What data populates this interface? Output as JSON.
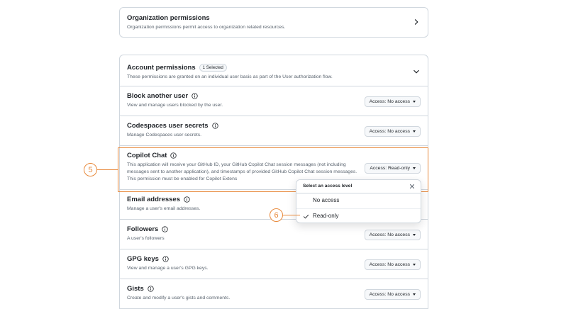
{
  "org": {
    "title": "Organization permissions",
    "description": "Organization permissions permit access to organization related resources."
  },
  "account": {
    "title": "Account permissions",
    "badge": "1 Selected",
    "description": "These permissions are granted on an individual user basis as part of the User authorization flow.",
    "rows": [
      {
        "title": "Block another user",
        "description": "View and manage users blocked by the user.",
        "access": "Access: No access"
      },
      {
        "title": "Codespaces user secrets",
        "description": "Manage Codespaces user secrets.",
        "access": "Access: No access"
      },
      {
        "title": "Copilot Chat",
        "description": "This application will receive your GitHub ID, your GitHub Copilot Chat session messages (not including messages sent to another application), and timestamps of provided GitHub Copilot Chat session messages. This permission must be enabled for Copilot Extens",
        "access": "Access: Read-only"
      },
      {
        "title": "Email addresses",
        "description": "Manage a user's email addresses.",
        "access": ""
      },
      {
        "title": "Followers",
        "description": "A user's followers",
        "access": "Access: No access"
      },
      {
        "title": "GPG keys",
        "description": "View and manage a user's GPG keys.",
        "access": "Access: No access"
      },
      {
        "title": "Gists",
        "description": "Create and modify a user's gists and comments.",
        "access": "Access: No access"
      }
    ]
  },
  "dropdown": {
    "title": "Select an access level",
    "options": [
      "No access",
      "Read-only"
    ],
    "selected": "Read-only"
  },
  "callouts": {
    "first": "5",
    "second": "6"
  },
  "colors": {
    "accent": "#e8893b",
    "border": "#d0d7de",
    "text": "#1f2328",
    "muted": "#59636e"
  }
}
